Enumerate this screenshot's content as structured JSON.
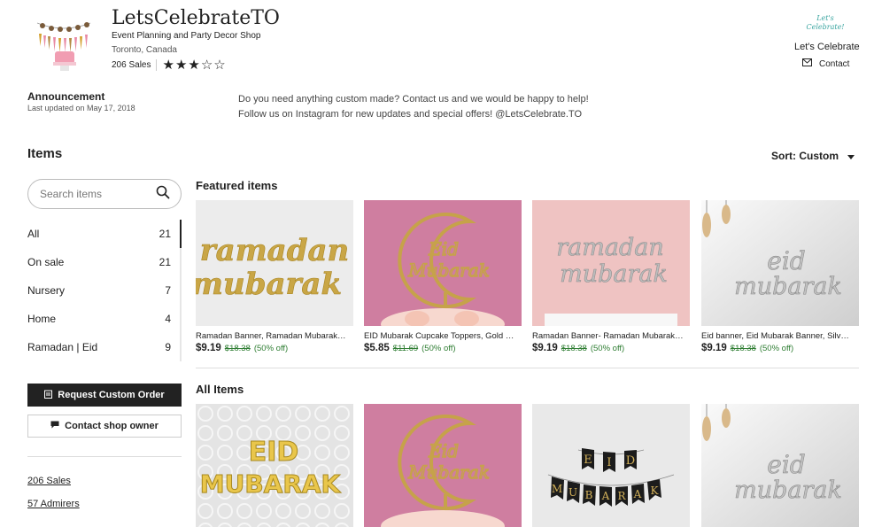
{
  "shop": {
    "name": "LetsCelebrateTO",
    "tagline": "Event Planning and Party Decor Shop",
    "location": "Toronto, Canada",
    "sales": "206 Sales",
    "rating": 3,
    "rating_max": 5
  },
  "owner": {
    "logo_text": "Let's Celebrate!",
    "name": "Let's Celebrate",
    "contact_label": "Contact"
  },
  "announcement": {
    "title": "Announcement",
    "updated": "Last updated on May 17, 2018",
    "line1": "Do you need anything custom made? Contact us and we would be happy to help!",
    "line2": "Follow us on Instagram for new updates and special offers! @LetsCelebrate.TO"
  },
  "items": {
    "title": "Items",
    "search_placeholder": "Search items",
    "categories": [
      {
        "label": "All",
        "count": "21"
      },
      {
        "label": "On sale",
        "count": "21"
      },
      {
        "label": "Nursery",
        "count": "7"
      },
      {
        "label": "Home",
        "count": "4"
      },
      {
        "label": "Ramadan | Eid",
        "count": "9"
      }
    ],
    "request_custom_label": "Request Custom Order",
    "contact_owner_label": "Contact shop owner",
    "sales_link": "206 Sales",
    "admirers_link": "57 Admirers"
  },
  "sort": {
    "label": "Sort: Custom"
  },
  "featured": {
    "title": "Featured items",
    "cards": [
      {
        "title": "Ramadan Banner, Ramadan Mubarak banner",
        "price": "$9.19",
        "was": "$18.38",
        "off": "(50% off)"
      },
      {
        "title": "EID Mubarak Cupcake Toppers, Gold Glitter",
        "price": "$5.85",
        "was": "$11.69",
        "off": "(50% off)"
      },
      {
        "title": "Ramadan Banner- Ramadan Mubarak banner",
        "price": "$9.19",
        "was": "$18.38",
        "off": "(50% off)"
      },
      {
        "title": "Eid banner, Eid Mubarak Banner, Silver Eid",
        "price": "$9.19",
        "was": "$18.38",
        "off": "(50% off)"
      }
    ]
  },
  "all_items": {
    "title": "All Items"
  },
  "colors": {
    "accent_dark": "#222222",
    "sale_green": "#2e7d32",
    "pink_bg": "#cf7ea0",
    "soft_pink": "#efc3c2"
  }
}
